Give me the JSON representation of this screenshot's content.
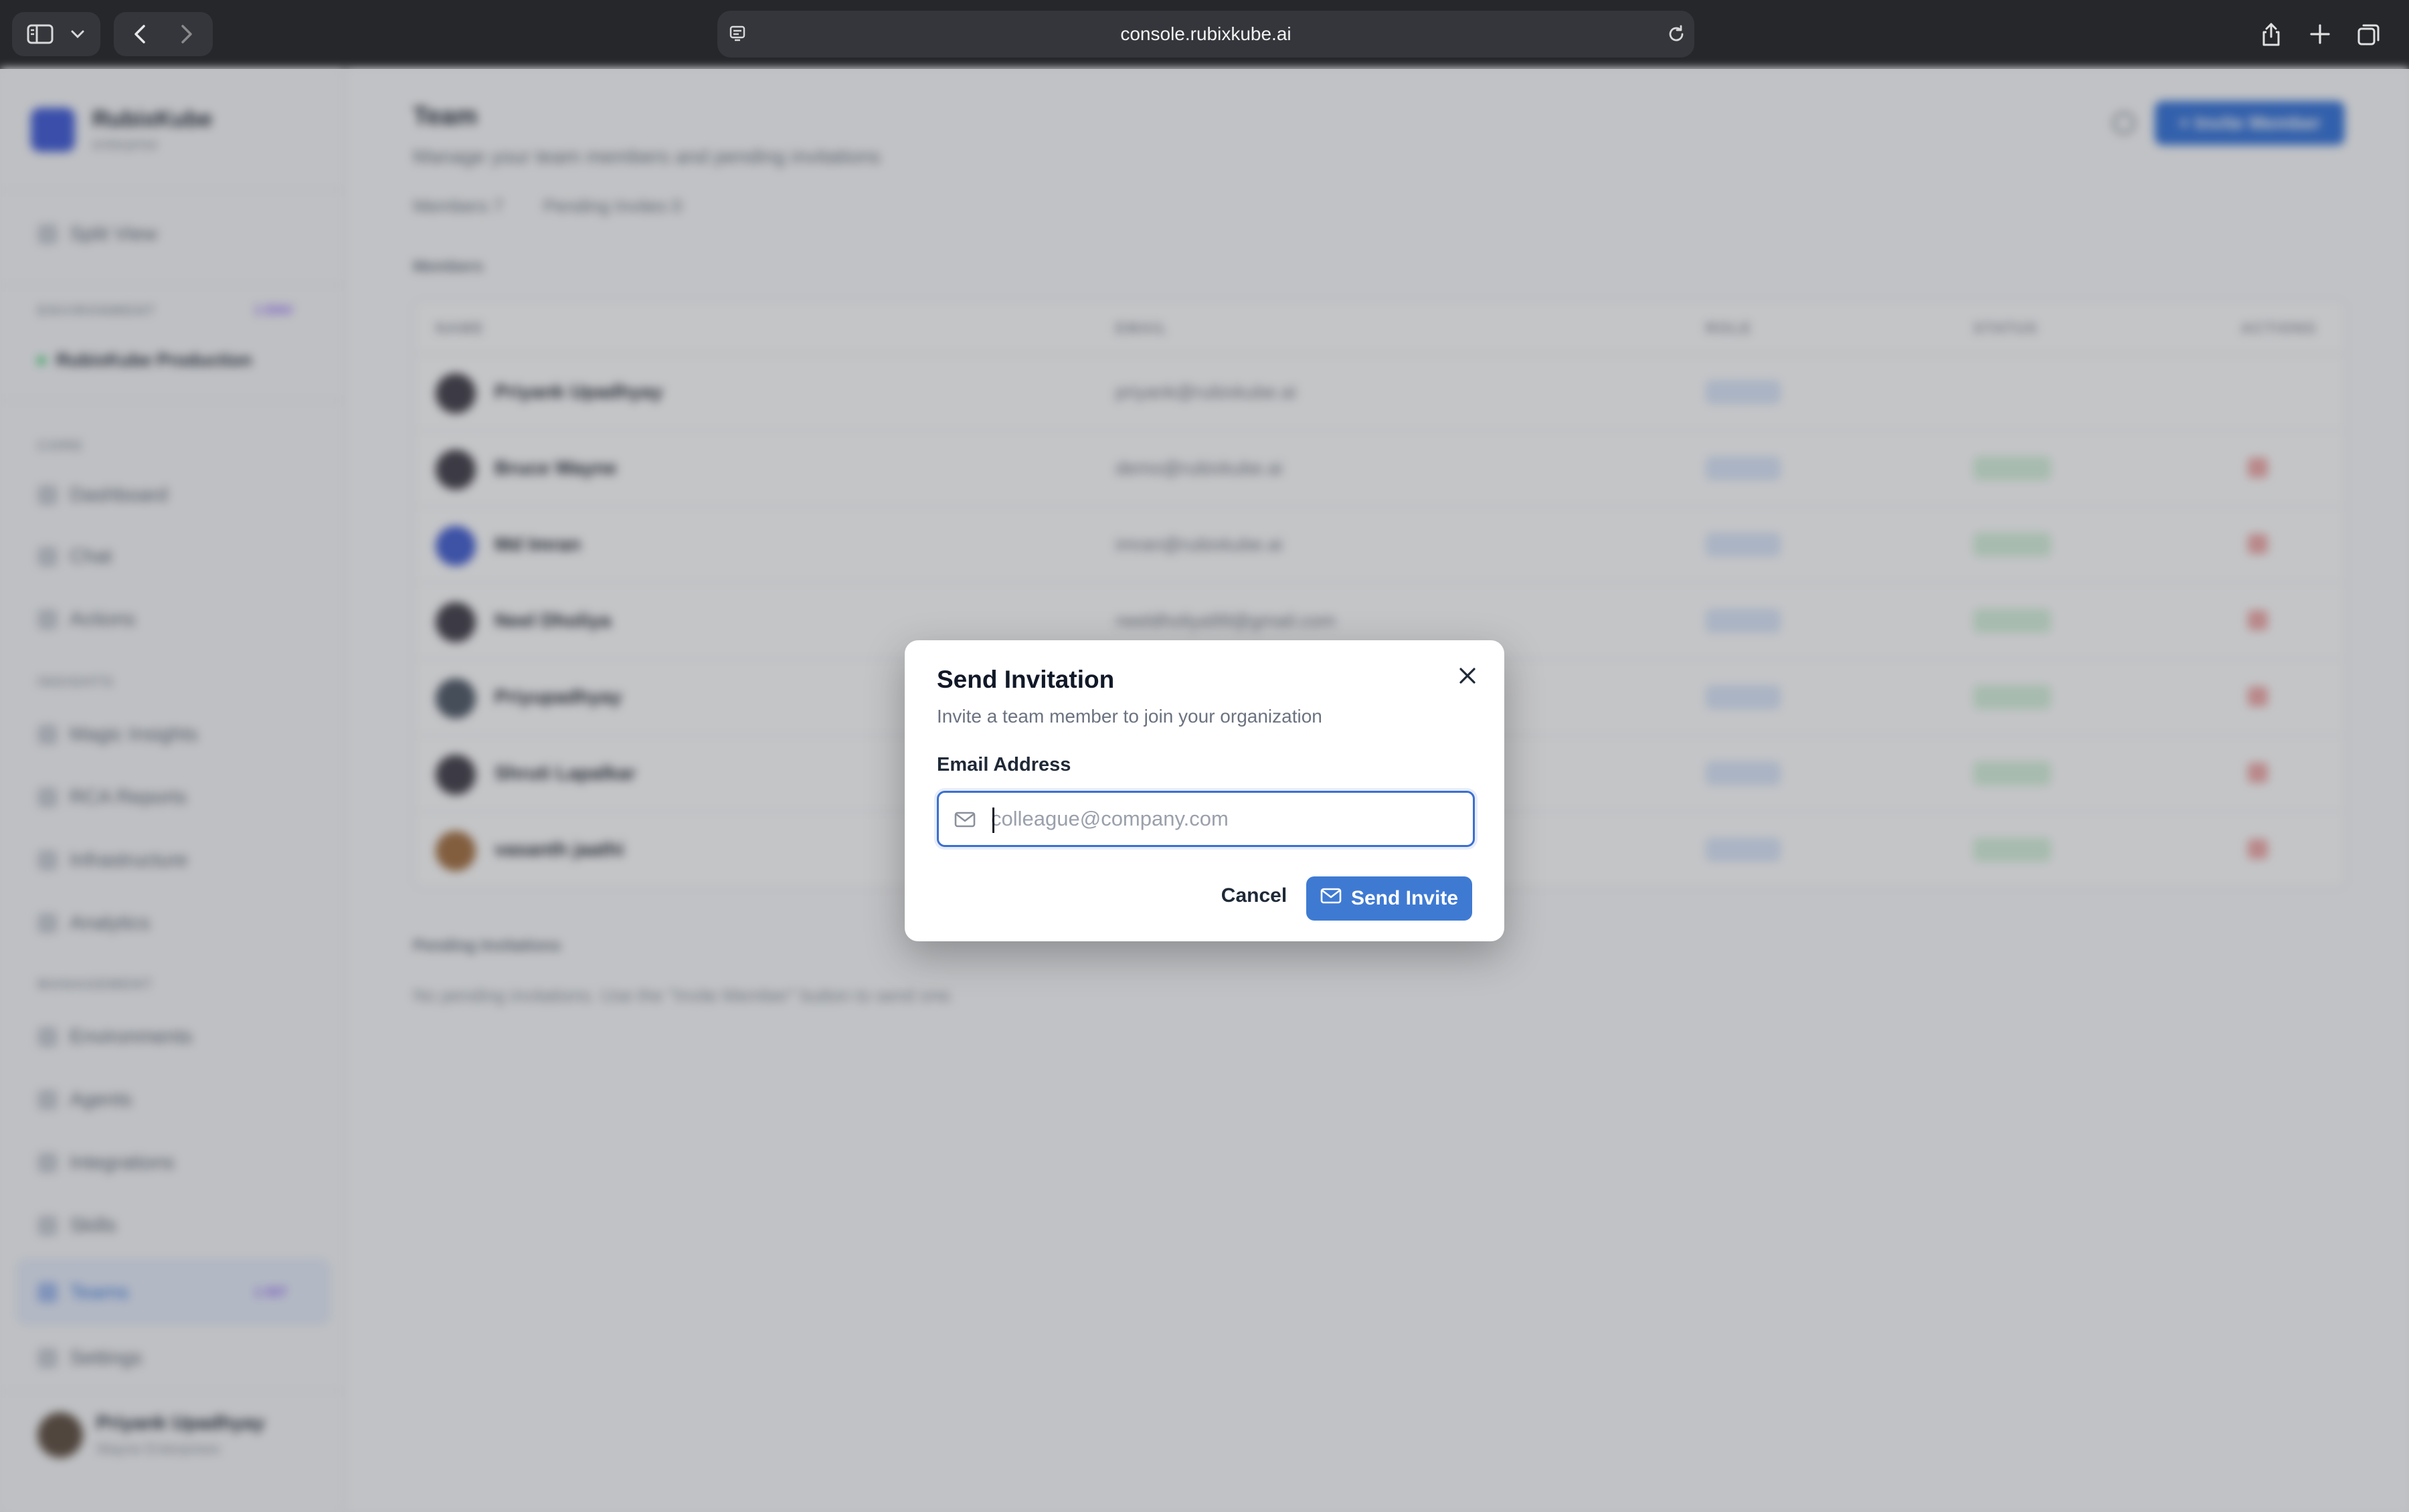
{
  "browser": {
    "url": "console.rubixkube.ai"
  },
  "sidebar": {
    "brand": "RubixKube",
    "brand_sub": "enterprise",
    "split_view": "Split View",
    "environment_label": "ENVIRONMENT",
    "environment_tag": "1 ENV",
    "environment_name": "RubixKube Production",
    "sections": {
      "core": "CORE",
      "insights": "INSIGHTS",
      "management": "MANAGEMENT"
    },
    "core_items": [
      "Dashboard",
      "Chat",
      "Actions"
    ],
    "insight_items": [
      "Magic Insights",
      "RCA Reports",
      "Infrastructure",
      "Analytics"
    ],
    "management_items": [
      "Environments",
      "Agents",
      "Integrations",
      "Skills"
    ],
    "teams": "Teams",
    "teams_tag": "1 INT",
    "settings": "Settings",
    "user_name": "Priyank Upadhyay",
    "user_org": "Wayne Enterprises"
  },
  "main": {
    "title": "Team",
    "subtitle": "Manage your team members and pending invitations",
    "members_stat": "Members  7",
    "pending_stat": "Pending Invites  0",
    "invite_button": "+ Invite Member",
    "members_label": "Members",
    "columns": [
      "NAME",
      "EMAIL",
      "ROLE",
      "STATUS",
      "ACTIONS"
    ],
    "rows": [
      {
        "name": "Priyank Upadhyay",
        "email": "priyank@rubixkube.ai"
      },
      {
        "name": "Bruce Wayne",
        "email": "demo@rubixkube.ai"
      },
      {
        "name": "Md Imran",
        "email": "imran@rubixkube.ai"
      },
      {
        "name": "Neel Dholiya",
        "email": "neeldholiya99@gmail.com"
      },
      {
        "name": "Priyupadhyay",
        "email": ""
      },
      {
        "name": "Shruti Lapalkar",
        "email": ""
      },
      {
        "name": "vasanth jaathi",
        "email": ""
      }
    ],
    "pending_label": "Pending Invitations",
    "pending_text": "No pending invitations. Use the \"Invite Member\" button to send one."
  },
  "modal": {
    "title": "Send Invitation",
    "subtitle": "Invite a team member to join your organization",
    "field_label": "Email Address",
    "email_value": "",
    "email_placeholder": "colleague@company.com",
    "cancel_label": "Cancel",
    "send_label": "Send Invite"
  },
  "colors": {
    "primary": "#3f7ad2",
    "focus_ring": "#3b6fcf",
    "chrome_bg": "#25272b"
  },
  "icons": [
    "sidebar-toggle-icon",
    "chevron-down-icon",
    "back-arrow-icon",
    "forward-arrow-icon",
    "site-settings-icon",
    "reload-icon",
    "share-icon",
    "new-tab-icon",
    "tabs-overview-icon",
    "close-icon",
    "mail-icon"
  ]
}
